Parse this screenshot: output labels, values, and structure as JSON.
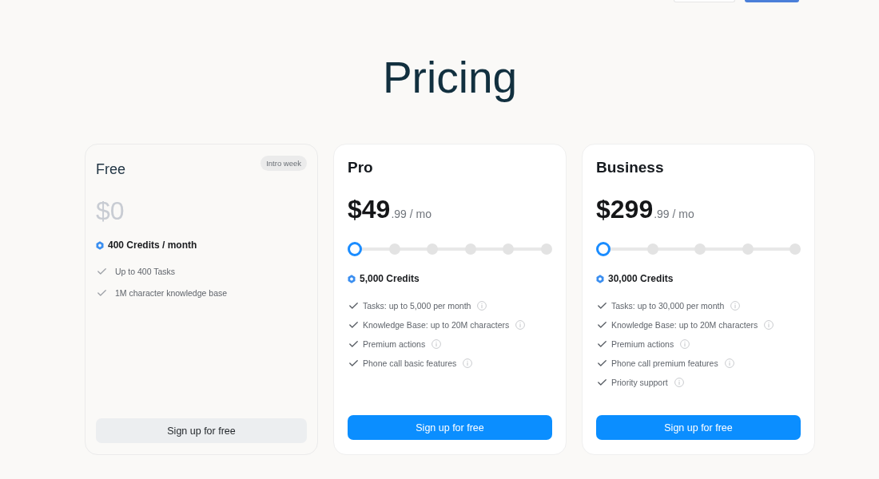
{
  "header": {
    "buttons": [
      {
        "kind": "outline"
      },
      {
        "kind": "primary"
      }
    ]
  },
  "title": "Pricing",
  "plans": [
    {
      "kind": "free",
      "name": "Free",
      "badge": "Intro week",
      "price": {
        "amount": "$0"
      },
      "credits": "400 Credits / month",
      "features": [
        {
          "text": "Up to 400 Tasks",
          "info": false
        },
        {
          "text": "1M character knowledge base",
          "info": false
        }
      ],
      "button": "Sign up for free"
    },
    {
      "kind": "paid",
      "name": "Pro",
      "price": {
        "amount": "$49",
        "suffix": ".99 / mo"
      },
      "slider": {
        "stops": [
          {
            "selected": true
          },
          {
            "selected": false
          },
          {
            "selected": false
          },
          {
            "selected": false
          },
          {
            "selected": false
          },
          {
            "selected": false
          }
        ]
      },
      "credits": "5,000 Credits",
      "features": [
        {
          "text": "Tasks: up to 5,000 per month",
          "info": true
        },
        {
          "text": "Knowledge Base: up to 20M characters",
          "info": true
        },
        {
          "text": "Premium actions",
          "info": true
        },
        {
          "text": "Phone call basic features",
          "info": true
        }
      ],
      "button": "Sign up for free"
    },
    {
      "kind": "paid",
      "name": "Business",
      "price": {
        "amount": "$299",
        "suffix": ".99 / mo"
      },
      "slider": {
        "stops": [
          {
            "selected": true
          },
          {
            "selected": false
          },
          {
            "selected": false
          },
          {
            "selected": false
          },
          {
            "selected": false
          }
        ]
      },
      "credits": "30,000 Credits",
      "features": [
        {
          "text": "Tasks: up to 30,000 per month",
          "info": true
        },
        {
          "text": "Knowledge Base: up to 20M characters",
          "info": true
        },
        {
          "text": "Premium actions",
          "info": true
        },
        {
          "text": "Phone call premium features",
          "info": true
        },
        {
          "text": "Priority support",
          "info": true
        }
      ],
      "button": "Sign up for free"
    }
  ]
}
